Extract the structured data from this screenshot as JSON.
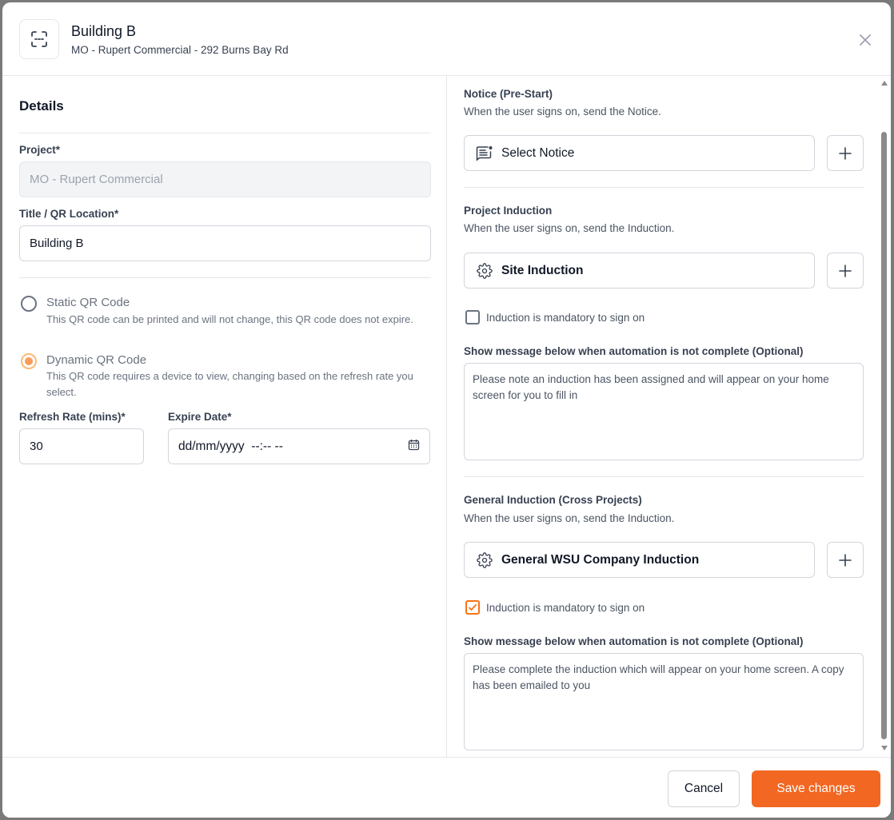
{
  "header": {
    "title": "Building B",
    "subtitle": "MO - Rupert Commercial - 292 Burns Bay Rd"
  },
  "left": {
    "section_title": "Details",
    "project_label": "Project*",
    "project_value": "MO - Rupert Commercial",
    "title_label": "Title / QR Location*",
    "title_value": "Building B",
    "static_title": "Static QR Code",
    "static_desc": "This QR code can be printed and will not change, this QR code does not expire.",
    "dynamic_title": "Dynamic QR Code",
    "dynamic_desc": "This QR code requires a device to view, changing based on the refresh rate you select.",
    "selected_qr": "dynamic",
    "refresh_label": "Refresh Rate (mins)*",
    "refresh_value": "30",
    "expire_label": "Expire Date*",
    "expire_placeholder": "dd/mm/yyyy  --:-- --"
  },
  "right": {
    "notice": {
      "heading": "Notice (Pre-Start)",
      "desc": "When the user signs on, send the Notice.",
      "select_label": "Select Notice"
    },
    "project_induction": {
      "heading": "Project Induction",
      "desc": "When the user signs on, send the Induction.",
      "select_label": "Site Induction",
      "mandatory_label": "Induction is mandatory to sign on",
      "mandatory_checked": false,
      "message_label": "Show message below when automation is not complete (Optional)",
      "message_value": "Please note an induction has been assigned and will appear on your home screen for you to fill in"
    },
    "general_induction": {
      "heading": "General Induction (Cross Projects)",
      "desc": "When the user signs on, send the Induction.",
      "select_label": "General WSU Company Induction",
      "mandatory_label": "Induction is mandatory to sign on",
      "mandatory_checked": true,
      "message_label": "Show message below when automation is not complete (Optional)",
      "message_value": "Please complete the induction which will appear on your home screen. A copy has been emailed to you"
    }
  },
  "footer": {
    "cancel_label": "Cancel",
    "save_label": "Save changes"
  },
  "colors": {
    "accent": "#f26722",
    "border": "#d1d5db"
  },
  "icons": {
    "header": "qr-scan-icon",
    "close": "close-icon",
    "notice": "notice-list-icon",
    "induction": "gear-icon",
    "calendar": "calendar-icon",
    "plus": "plus-icon"
  }
}
